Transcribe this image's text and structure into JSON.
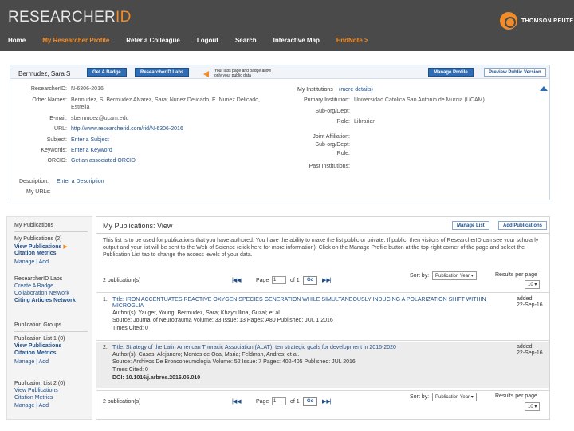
{
  "header": {
    "logo_main": "RESEARCHER",
    "logo_accent": "ID",
    "company": "THOMSON REUTE",
    "nav": [
      "Home",
      "My Researcher Profile",
      "Refer a Colleague",
      "Logout",
      "Search",
      "Interactive Map",
      "EndNote >"
    ]
  },
  "profile": {
    "name": "Bermudez, Sara S",
    "get_badge": "Get A Badge",
    "labs": "ResearcherID Labs",
    "note": "Your labs page and badge allow only your public data",
    "manage_profile": "Manage Profile",
    "preview": "Preview Public Version",
    "researcherid_label": "ResearcherID:",
    "researcherid": "N-6306-2016",
    "other_names_label": "Other Names:",
    "other_names_1": "Bermudez, S. Bermudez Alvarez, Sara; Nunez Delicado, E. Nunez Delicado,",
    "other_names_2": "Estrella",
    "email_label": "E-mail:",
    "email": "sbermudez@ucam.edu",
    "url_label": "URL:",
    "url": "http://www.researcherid.com/rid/N-6306-2016",
    "subject_label": "Subject:",
    "subject": "Enter a Subject",
    "keywords_label": "Keywords:",
    "keywords": "Enter a Keyword",
    "orcid_label": "ORCID:",
    "orcid": "Get an associated ORCID",
    "description_label": "Description:",
    "description": "Enter a Description",
    "urls_label": "My URLs:",
    "institutions_title": "My Institutions",
    "institutions_more": "(more details)",
    "primary_label": "Primary Institution:",
    "primary": "Universidad Catolica San Antonio de Murcia (UCAM)",
    "suborg_label": "Sub-org/Dept:",
    "role_label": "Role:",
    "role": "Librarian",
    "joint_label": "Joint Affiliation:",
    "suborg2_label": "Sub-org/Dept:",
    "role2_label": "Role:",
    "past_label": "Past Institutions:"
  },
  "sidebar": {
    "my_publications": "My Publications",
    "my_publications_count": "My Publications (2)",
    "view_publications": "View Publications",
    "citation_metrics": "Citation Metrics",
    "manage_add": "Manage | Add",
    "labs": "ResearcherID Labs",
    "create_badge": "Create A Badge",
    "collab_network": "Collaboration Network",
    "citing_network": "Citing Articles Network",
    "groups": "Publication Groups",
    "list1": "Publication List 1 (0)",
    "list1_view": "View Publications",
    "list1_metrics": "Citation Metrics",
    "list1_manage": "Manage | Add",
    "list2": "Publication List 2 (0)",
    "list2_view": "View Publications",
    "list2_metrics": "Citation Metrics",
    "list2_manage": "Manage | Add"
  },
  "main": {
    "title": "My Publications: View",
    "manage_list": "Manage List",
    "add_publications": "Add Publications",
    "paragraph": "This list is to be used for publications that you have authored. You have the ability to make the list public or private. If public, then visitors of ResearcherID can see your scholarly output and your list will be sent to the Web of Science (click here for more information). Click on the Manage Profile button at the top-right corner of the page and select the Publication List tab to change the access levels of your data.",
    "count": "2 publication(s)",
    "page_label": "Page",
    "page_value": "1",
    "of_label": "of 1",
    "go": "Go",
    "sort_label": "Sort by:",
    "sort_value": "Publication Year",
    "results_label": "Results per page",
    "results_value": "10",
    "pubs": [
      {
        "num": "1.",
        "title_line": "Title: IRON ACCENTUATES REACTIVE OXYGEN SPECIES GENERATION WHILE SIMULTANEOUSLY INDUCING A POLARIZATION SHIFT WITHIN",
        "title_line2": "MICROGLIA",
        "authors": "Author(s): Yauger, Young; Bermudez, Sara; Khayrullina, Guzal; et al.",
        "source": "Source: Journal of Neurotrauma Volume: 33 Issue: 13 Pages: A80 Published: JUL 1 2016",
        "cited": "Times Cited: 0",
        "added": "added",
        "date": "22-Sep-16"
      },
      {
        "num": "2.",
        "title_line": "Title: Strategy of the Latin American Thoracic Association (ALAT): ten strategic goals for development in 2016-2020",
        "authors": "Author(s): Casas, Alejandro; Montes de Oca, Maria; Feldman, Andres; et al.",
        "source": "Source: Archivos De Bronconeumologia Volume: 52 Issue: 7 Pages: 402-405 Published: JUL 2016",
        "cited": "Times Cited: 0",
        "doi": "DOI: 10.1016/j.arbres.2016.05.010",
        "added": "added",
        "date": "22-Sep-16"
      }
    ]
  }
}
